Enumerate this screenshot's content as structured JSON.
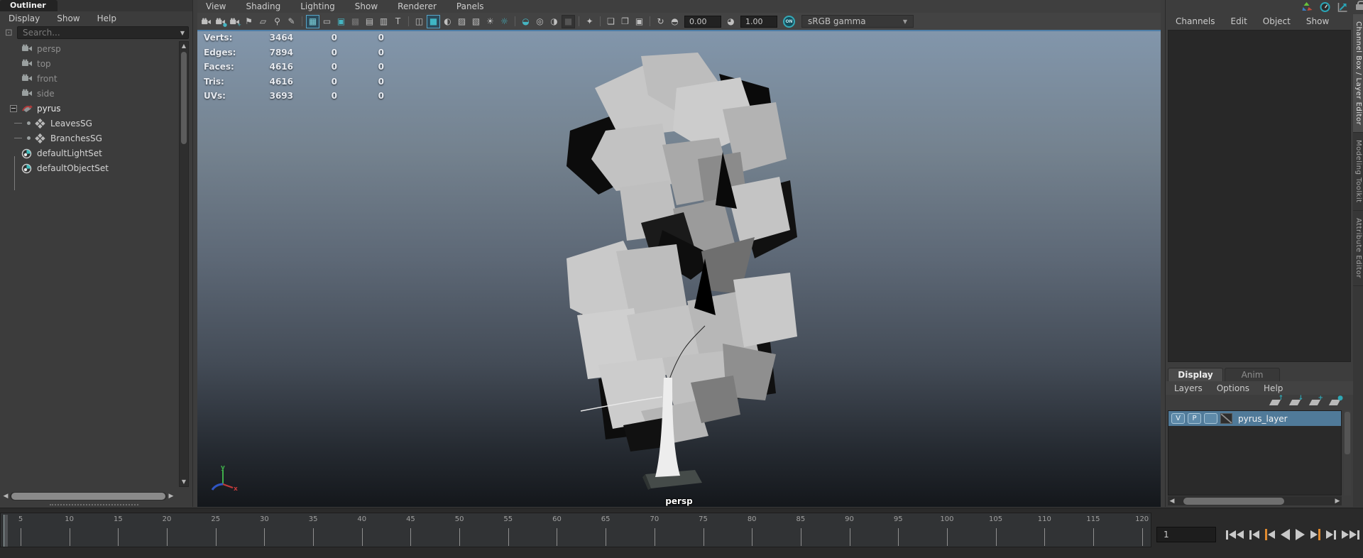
{
  "colors": {
    "panel_bg": "#3d3d3d",
    "viewport_gradient_top": "#8296ab",
    "viewport_gradient_bottom": "#14171b",
    "active_border_blue": "#4e7ea8",
    "selection_blue": "#507a99",
    "teal_accent": "#35a9b7",
    "key_orange": "#e08a2e"
  },
  "outliner": {
    "tab_label": "Outliner",
    "menus": [
      "Display",
      "Show",
      "Help"
    ],
    "search_placeholder": "Search...",
    "filter_icon": "search-filter-icon",
    "items": [
      {
        "label": "persp",
        "type": "camera",
        "dimmed": true
      },
      {
        "label": "top",
        "type": "camera",
        "dimmed": true
      },
      {
        "label": "front",
        "type": "camera",
        "dimmed": true
      },
      {
        "label": "side",
        "type": "camera",
        "dimmed": true
      },
      {
        "label": "pyrus",
        "type": "transform",
        "expanded": true
      },
      {
        "label": "LeavesSG",
        "type": "shading-group",
        "child": true
      },
      {
        "label": "BranchesSG",
        "type": "shading-group",
        "child": true
      },
      {
        "label": "defaultLightSet",
        "type": "set"
      },
      {
        "label": "defaultObjectSet",
        "type": "set"
      }
    ]
  },
  "viewport": {
    "menus": [
      "View",
      "Shading",
      "Lighting",
      "Show",
      "Renderer",
      "Panels"
    ],
    "toolbar": [
      {
        "name": "select-camera-icon",
        "glyph": "cam"
      },
      {
        "name": "lock-camera-icon",
        "glyph": "cam",
        "badge": "●"
      },
      {
        "name": "camera-attributes-icon",
        "glyph": "cam",
        "badge": "+"
      },
      {
        "name": "bookmark-icon",
        "glyph": "⚑"
      },
      {
        "name": "image-plane-icon",
        "glyph": "▱"
      },
      {
        "name": "pan-zoom-icon",
        "glyph": "⚲"
      },
      {
        "name": "grease-pencil-icon",
        "glyph": "✎"
      },
      {
        "separator": true
      },
      {
        "name": "grid-icon",
        "glyph": "▦",
        "state": "active"
      },
      {
        "name": "film-gate-icon",
        "glyph": "▭"
      },
      {
        "name": "resolution-gate-icon",
        "glyph": "▣",
        "state": "teal"
      },
      {
        "name": "gate-mask-icon",
        "glyph": "▩",
        "state": "dim"
      },
      {
        "name": "field-chart-icon",
        "glyph": "▤"
      },
      {
        "name": "safe-action-icon",
        "glyph": "▥"
      },
      {
        "name": "safe-title-icon",
        "glyph": "T"
      },
      {
        "separator": true
      },
      {
        "name": "wireframe-icon",
        "glyph": "◫"
      },
      {
        "name": "smooth-shade-icon",
        "glyph": "■",
        "state": "active-teal"
      },
      {
        "name": "wireframe-on-shaded-icon",
        "glyph": "◐"
      },
      {
        "name": "textured-icon",
        "glyph": "▨"
      },
      {
        "name": "use-default-material-icon",
        "glyph": "▧"
      },
      {
        "name": "all-lights-icon",
        "glyph": "☀"
      },
      {
        "name": "flat-lighting-icon",
        "glyph": "☼",
        "state": "teal"
      },
      {
        "separator": true
      },
      {
        "name": "shadows-icon",
        "glyph": "◒",
        "state": "teal"
      },
      {
        "name": "depth-of-field-icon",
        "glyph": "◎"
      },
      {
        "name": "ambient-occlusion-icon",
        "glyph": "◑"
      },
      {
        "name": "multisample-anti-aliasing-icon",
        "glyph": "■",
        "state": "pressed"
      },
      {
        "separator": true
      },
      {
        "name": "isolate-select-icon",
        "glyph": "✦"
      },
      {
        "separator": true
      },
      {
        "name": "xray-icon",
        "glyph": "❏"
      },
      {
        "name": "xray-active-components-icon",
        "glyph": "❐"
      },
      {
        "name": "xray-joints-icon",
        "glyph": "▣"
      },
      {
        "separator": true
      },
      {
        "name": "lighting-refresh-icon",
        "glyph": "↻"
      },
      {
        "name": "exposure-icon",
        "glyph": "◓"
      },
      {
        "field": "exposure"
      },
      {
        "name": "contrast-icon",
        "glyph": "◕"
      },
      {
        "field": "gamma"
      },
      {
        "toggle": true
      },
      {
        "dropdown": true
      }
    ],
    "toolbar_fields": {
      "exposure": "0.00",
      "gamma": "1.00",
      "on_label": "ON",
      "colorspace": "sRGB gamma"
    },
    "hud": {
      "rows": [
        {
          "label": "Verts:",
          "values": [
            "3464",
            "0",
            "0"
          ]
        },
        {
          "label": "Edges:",
          "values": [
            "7894",
            "0",
            "0"
          ]
        },
        {
          "label": "Faces:",
          "values": [
            "4616",
            "0",
            "0"
          ]
        },
        {
          "label": "Tris:",
          "values": [
            "4616",
            "0",
            "0"
          ]
        },
        {
          "label": "UVs:",
          "values": [
            "3693",
            "0",
            "0"
          ]
        }
      ]
    },
    "camera_label": "persp",
    "axis_labels": {
      "x": "x",
      "y": "y"
    }
  },
  "channel_box": {
    "menus": [
      "Channels",
      "Edit",
      "Object",
      "Show"
    ],
    "corner_icons": [
      "character-set-icon",
      "evaluation-gauge-icon",
      "graph-trend-icon",
      "lock-icon"
    ]
  },
  "side_tabs": [
    "Channel Box / Layer Editor",
    "Modeling Toolkit",
    "Attribute Editor"
  ],
  "layer_editor": {
    "tabs": [
      "Display",
      "Anim"
    ],
    "menus": [
      "Layers",
      "Options",
      "Help"
    ],
    "action_icons": [
      {
        "name": "move-layer-up-icon",
        "badge": "↑"
      },
      {
        "name": "move-layer-down-icon",
        "badge": "↓"
      },
      {
        "name": "create-empty-layer-icon",
        "badge": "+"
      },
      {
        "name": "create-layer-from-selected-icon",
        "badge": "●"
      }
    ],
    "layers": [
      {
        "visible": "V",
        "playback": "P",
        "extra": "",
        "name": "pyrus_layer",
        "selected": true
      }
    ]
  },
  "timeline": {
    "frame_labels": [
      5,
      10,
      15,
      20,
      25,
      30,
      35,
      40,
      45,
      50,
      55,
      60,
      65,
      70,
      75,
      80,
      85,
      90,
      95,
      100,
      105,
      110,
      115,
      120
    ],
    "current_frame": "1",
    "playback_buttons": [
      {
        "name": "go-to-start-button",
        "parts": [
          "bar",
          "tl",
          "tl"
        ]
      },
      {
        "name": "step-back-frame-button",
        "parts": [
          "bar",
          "tl"
        ]
      },
      {
        "name": "step-back-key-button",
        "parts": [
          "obar",
          "tl"
        ]
      },
      {
        "name": "play-backwards-button",
        "parts": [
          "TL"
        ]
      },
      {
        "name": "play-forward-button",
        "parts": [
          "TR"
        ]
      },
      {
        "name": "step-forward-key-button",
        "parts": [
          "tr",
          "obar"
        ]
      },
      {
        "name": "step-forward-frame-button",
        "parts": [
          "tr",
          "bar"
        ]
      },
      {
        "name": "go-to-end-button",
        "parts": [
          "tr",
          "tr",
          "bar"
        ]
      }
    ]
  }
}
